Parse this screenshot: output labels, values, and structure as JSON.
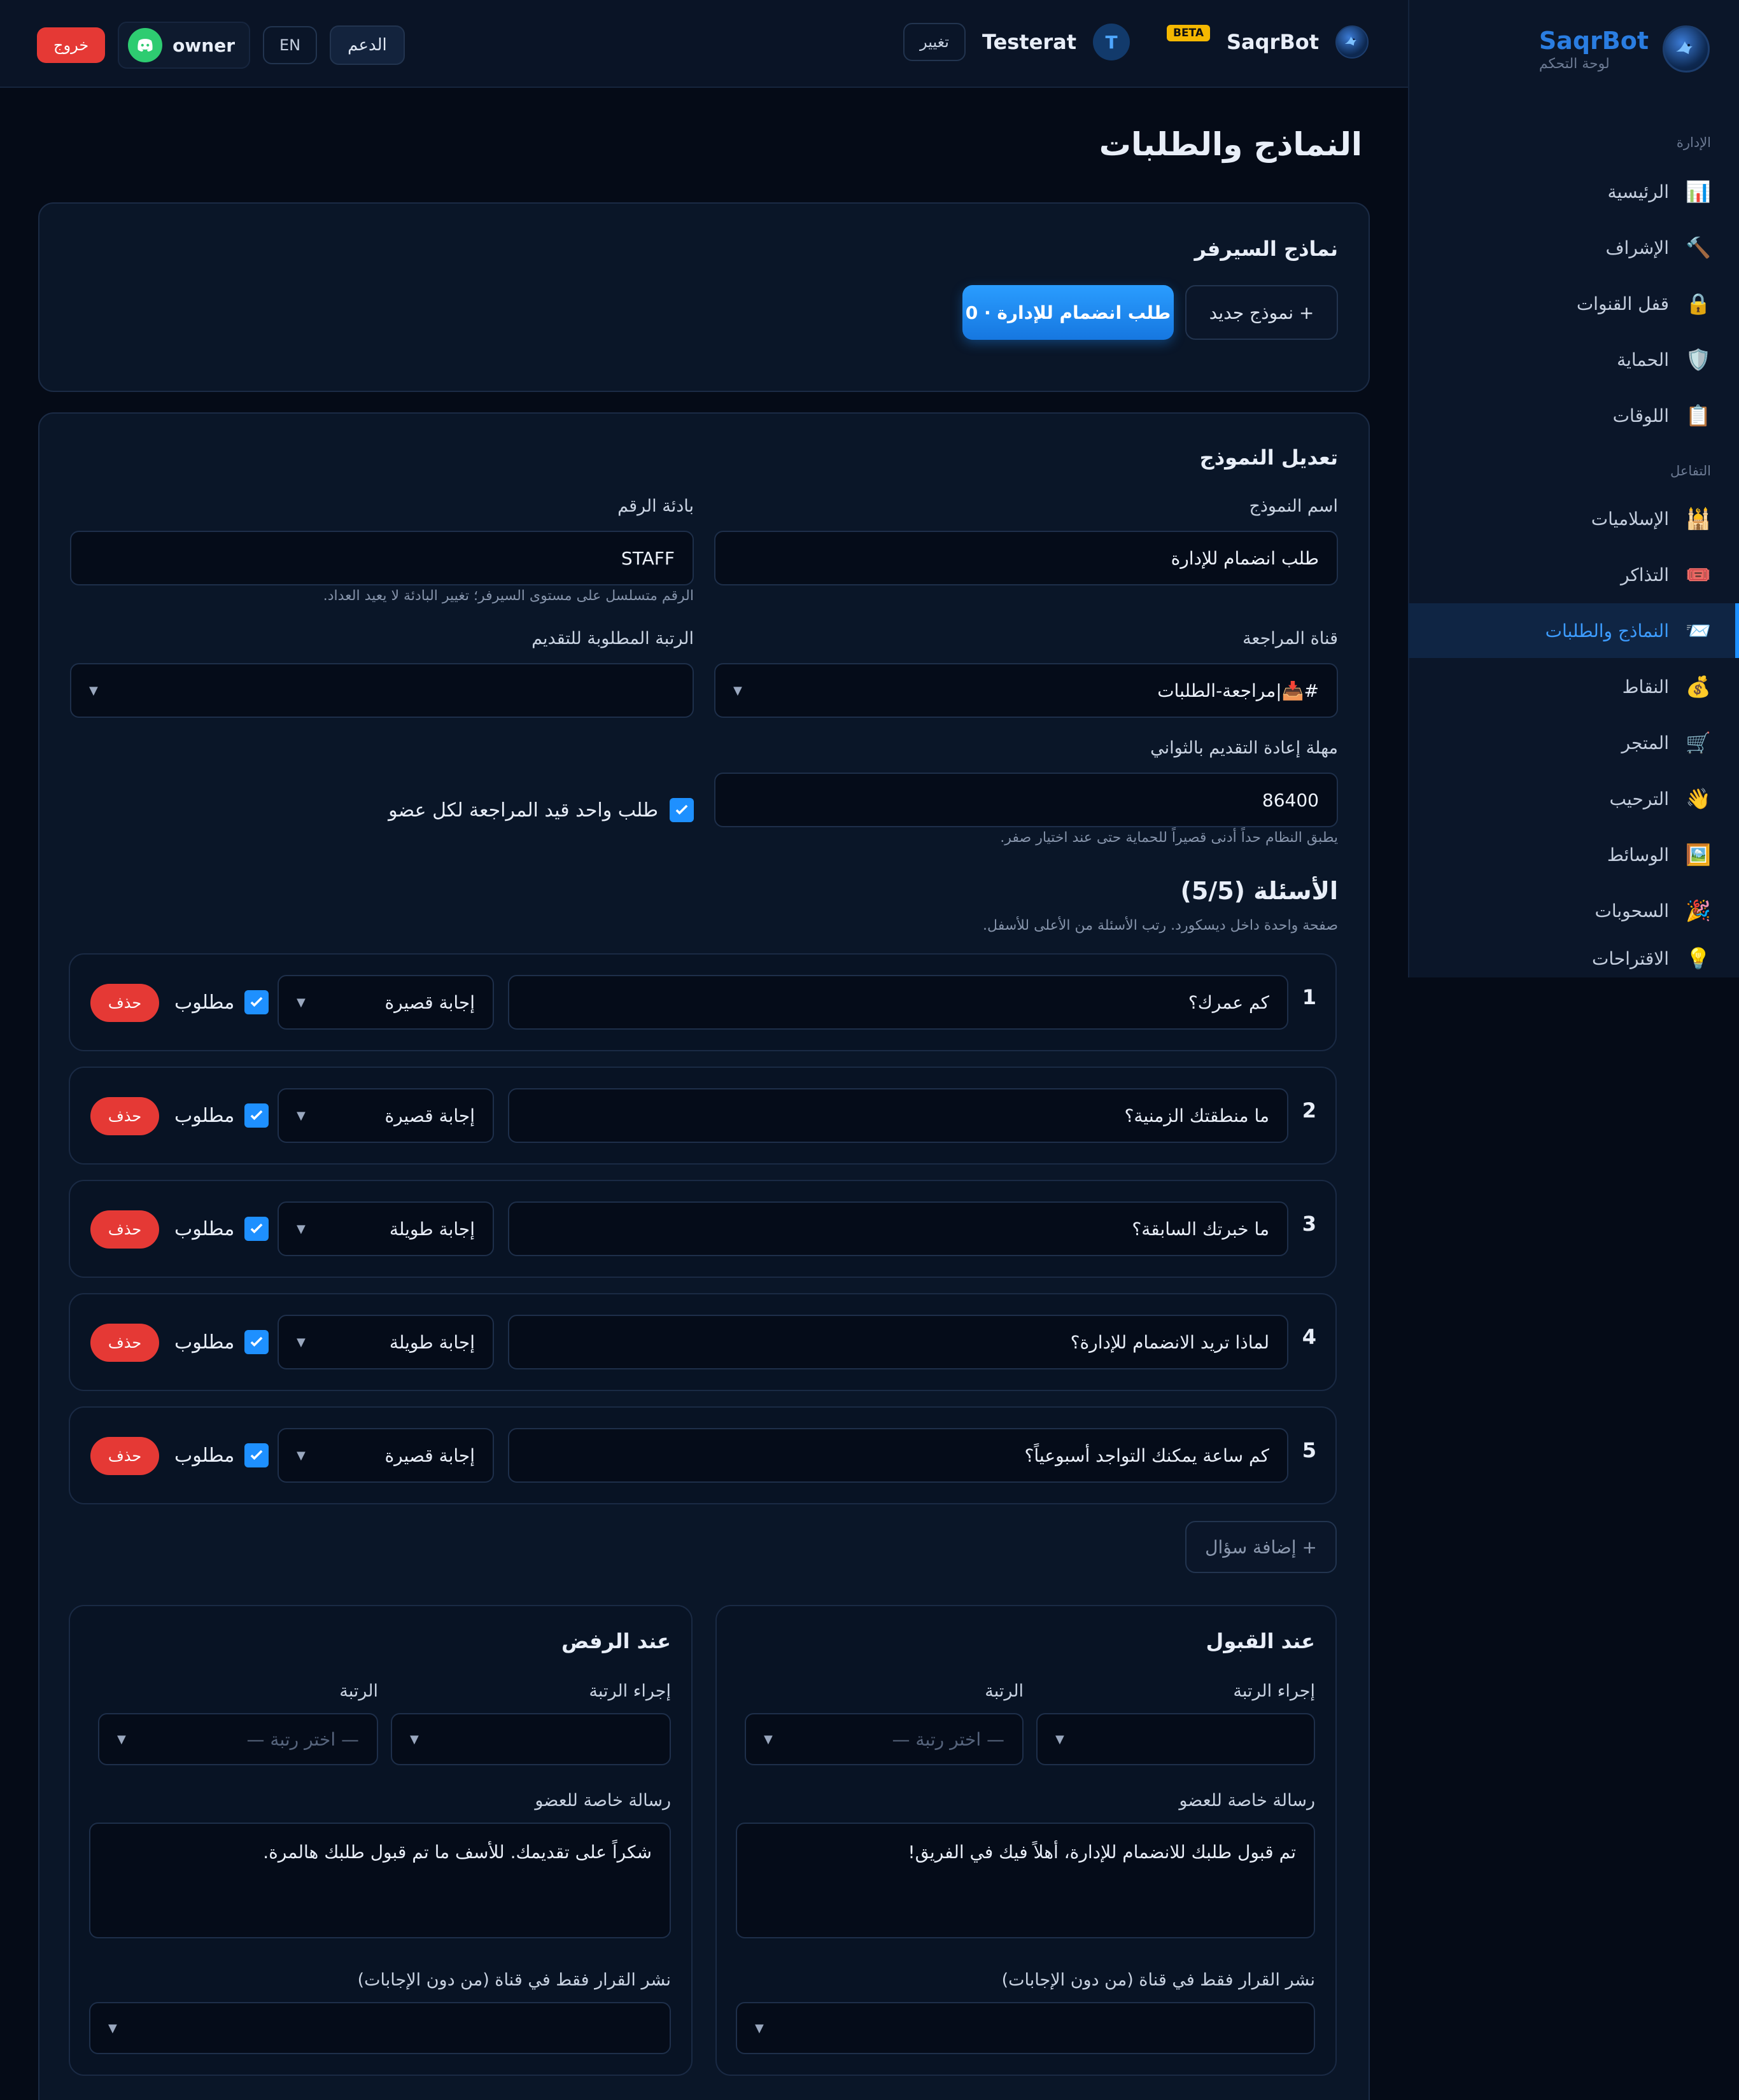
{
  "brand": {
    "name": "SaqrBot",
    "subtitle": "لوحة التحكم"
  },
  "topbar": {
    "bot_name": "SaqrBot",
    "beta": "BETA",
    "user_initial": "T",
    "user_name": "Testerat",
    "change_label": "تغيير",
    "support_label": "الدعم",
    "lang_label": "EN",
    "owner_label": "owner",
    "logout_label": "خروج"
  },
  "sidebar": {
    "group_admin": "الإدارة",
    "group_interaction": "التفاعل",
    "items": [
      {
        "label": "الرئيسية",
        "icon": "📊"
      },
      {
        "label": "الإشراف",
        "icon": "🔨"
      },
      {
        "label": "قفل القنوات",
        "icon": "🔒"
      },
      {
        "label": "الحماية",
        "icon": "🛡️"
      },
      {
        "label": "اللوقات",
        "icon": "📋"
      },
      {
        "label": "الإسلاميات",
        "icon": "🕌"
      },
      {
        "label": "التذاكر",
        "icon": "🎟️"
      },
      {
        "label": "النماذج والطلبات",
        "icon": "📨"
      },
      {
        "label": "النقاط",
        "icon": "💰"
      },
      {
        "label": "المتجر",
        "icon": "🛒"
      },
      {
        "label": "الترحيب",
        "icon": "👋"
      },
      {
        "label": "الوسائط",
        "icon": "🖼️"
      },
      {
        "label": "السحوبات",
        "icon": "🎉"
      },
      {
        "label": "الاقتراحات",
        "icon": "💡"
      }
    ]
  },
  "page": {
    "title": "النماذج والطلبات"
  },
  "forms_card": {
    "title": "نماذج السيرفر",
    "active_form": "طلب انضمام للإدارة · 0",
    "new_form": "+ نموذج جديد"
  },
  "edit": {
    "title": "تعديل النموذج",
    "name_label": "اسم النموذج",
    "name_value": "طلب انضمام للإدارة",
    "prefix_label": "بادئة الرقم",
    "prefix_value": "STAFF",
    "prefix_hint": "الرقم متسلسل على مستوى السيرفر؛ تغيير البادئة لا يعيد العداد.",
    "review_label": "قناة المراجعة",
    "review_value": "#📥|مراجعة-الطلبات",
    "role_label": "الرتبة المطلوبة للتقديم",
    "role_value": "",
    "cooldown_label": "مهلة إعادة التقديم بالثواني",
    "cooldown_value": "86400",
    "cooldown_hint": "يطبق النظام حداً أدنى قصيراً للحماية حتى عند اختيار صفر.",
    "single_pending": "طلب واحد قيد المراجعة لكل عضو"
  },
  "questions": {
    "title": "الأسئلة (5/5)",
    "subtitle": "صفحة واحدة داخل ديسكورد. رتب الأسئلة من الأعلى للأسفل.",
    "required_label": "مطلوب",
    "delete_label": "حذف",
    "add_label": "+ إضافة سؤال",
    "items": [
      {
        "num": "1",
        "text": "كم عمرك؟",
        "type": "إجابة قصيرة"
      },
      {
        "num": "2",
        "text": "ما منطقتك الزمنية؟",
        "type": "إجابة قصيرة"
      },
      {
        "num": "3",
        "text": "ما خبرتك السابقة؟",
        "type": "إجابة طويلة"
      },
      {
        "num": "4",
        "text": "لماذا تريد الانضمام للإدارة؟",
        "type": "إجابة طويلة"
      },
      {
        "num": "5",
        "text": "كم ساعة يمكنك التواجد أسبوعياً؟",
        "type": "إجابة قصيرة"
      }
    ]
  },
  "accept": {
    "title": "عند القبول",
    "role_action_label": "إجراء الرتبة",
    "role_label": "الرتبة",
    "role_placeholder": "— اختر رتبة —",
    "dm_label": "رسالة خاصة للعضو",
    "dm_value": "تم قبول طلبك للانضمام للإدارة، أهلاً فيك في الفريق!",
    "publish_label": "نشر القرار فقط في قناة (من دون الإجابات)"
  },
  "reject": {
    "title": "عند الرفض",
    "role_action_label": "إجراء الرتبة",
    "role_label": "الرتبة",
    "role_placeholder": "— اختر رتبة —",
    "dm_label": "رسالة خاصة للعضو",
    "dm_value": "شكراً على تقديمك. للأسف ما تم قبول طلبك هالمرة.",
    "publish_label": "نشر القرار فقط في قناة (من دون الإجابات)"
  }
}
